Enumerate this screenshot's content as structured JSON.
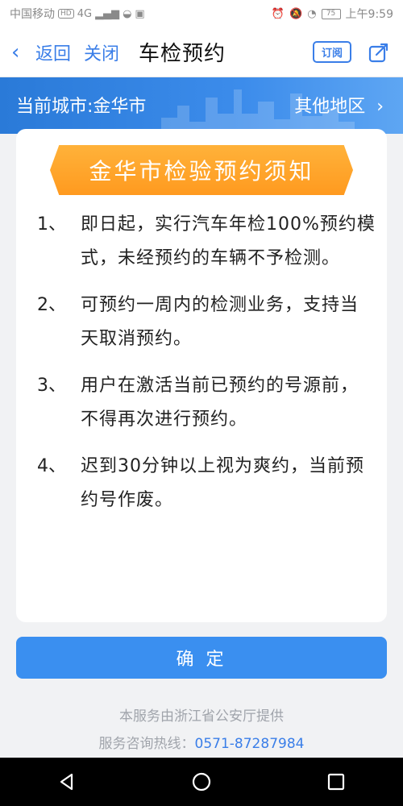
{
  "status_bar": {
    "carrier": "中国移动",
    "hd_badge": "HD",
    "network": "4G",
    "battery": "75",
    "time": "上午9:59"
  },
  "nav": {
    "back_label": "返回",
    "close_label": "关闭",
    "title": "车检预约",
    "subscribe_label": "订阅"
  },
  "city": {
    "current": "当前城市:金华市",
    "other": "其他地区"
  },
  "notice": {
    "title": "金华市检验预约须知",
    "rules": [
      {
        "num": "1、",
        "text": "即日起，实行汽车年检100%预约模式，未经预约的车辆不予检测。"
      },
      {
        "num": "2、",
        "text": "可预约一周内的检测业务，支持当天取消预约。"
      },
      {
        "num": "3、",
        "text": "用户在激活当前已预约的号源前，不得再次进行预约。"
      },
      {
        "num": "4、",
        "text": "迟到30分钟以上视为爽约，当前预约号作废。"
      }
    ]
  },
  "confirm_label": "确 定",
  "footer": {
    "provider": "本服务由浙江省公安厅提供",
    "hotline_label": "服务咨询热线：",
    "hotline_number": "0571-87287984"
  },
  "colors": {
    "accent": "#3a7ee8",
    "banner": "#2a7ad8",
    "notice_title_bg": "#ff9a1f"
  }
}
